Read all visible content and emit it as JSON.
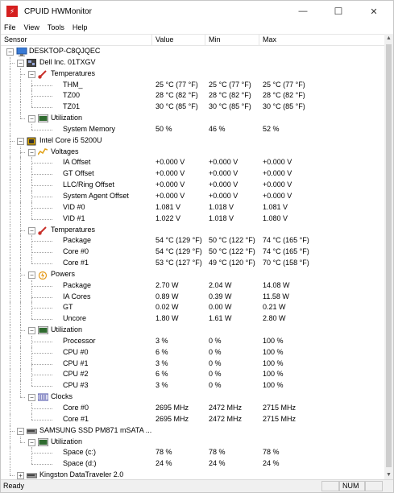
{
  "window": {
    "title": "CPUID HWMonitor",
    "minimize_glyph": "—",
    "maximize_glyph": "☐",
    "close_glyph": "✕"
  },
  "menu": {
    "file": "File",
    "view": "View",
    "tools": "Tools",
    "help": "Help"
  },
  "columns": {
    "sensor": "Sensor",
    "value": "Value",
    "min": "Min",
    "max": "Max"
  },
  "tree": [
    {
      "level": 0,
      "type": "root",
      "icon": "computer-icon",
      "label": "DESKTOP-C8QJQEC",
      "expanded": true
    },
    {
      "level": 1,
      "type": "device",
      "icon": "motherboard-icon",
      "label": "Dell Inc. 01TXGV",
      "expanded": true
    },
    {
      "level": 2,
      "type": "group",
      "icon": "thermometer-icon",
      "label": "Temperatures",
      "expanded": true
    },
    {
      "level": 3,
      "type": "sensor",
      "label": "THM_",
      "value": "25 °C  (77 °F)",
      "min": "25 °C  (77 °F)",
      "max": "25 °C  (77 °F)"
    },
    {
      "level": 3,
      "type": "sensor",
      "label": "TZ00",
      "value": "28 °C  (82 °F)",
      "min": "28 °C  (82 °F)",
      "max": "28 °C  (82 °F)"
    },
    {
      "level": 3,
      "type": "sensor",
      "label": "TZ01",
      "value": "30 °C  (85 °F)",
      "min": "30 °C  (85 °F)",
      "max": "30 °C  (85 °F)"
    },
    {
      "level": 2,
      "type": "group",
      "icon": "chip-icon",
      "label": "Utilization",
      "expanded": true
    },
    {
      "level": 3,
      "type": "sensor",
      "label": "System Memory",
      "value": "50 %",
      "min": "46 %",
      "max": "52 %"
    },
    {
      "level": 1,
      "type": "device",
      "icon": "cpu-icon",
      "label": "Intel Core i5 5200U",
      "expanded": true
    },
    {
      "level": 2,
      "type": "group",
      "icon": "voltage-icon",
      "label": "Voltages",
      "expanded": true
    },
    {
      "level": 3,
      "type": "sensor",
      "label": "IA Offset",
      "value": "+0.000 V",
      "min": "+0.000 V",
      "max": "+0.000 V"
    },
    {
      "level": 3,
      "type": "sensor",
      "label": "GT Offset",
      "value": "+0.000 V",
      "min": "+0.000 V",
      "max": "+0.000 V"
    },
    {
      "level": 3,
      "type": "sensor",
      "label": "LLC/Ring Offset",
      "value": "+0.000 V",
      "min": "+0.000 V",
      "max": "+0.000 V"
    },
    {
      "level": 3,
      "type": "sensor",
      "label": "System Agent Offset",
      "value": "+0.000 V",
      "min": "+0.000 V",
      "max": "+0.000 V"
    },
    {
      "level": 3,
      "type": "sensor",
      "label": "VID #0",
      "value": "1.081 V",
      "min": "1.018 V",
      "max": "1.081 V"
    },
    {
      "level": 3,
      "type": "sensor",
      "label": "VID #1",
      "value": "1.022 V",
      "min": "1.018 V",
      "max": "1.080 V"
    },
    {
      "level": 2,
      "type": "group",
      "icon": "thermometer-icon",
      "label": "Temperatures",
      "expanded": true
    },
    {
      "level": 3,
      "type": "sensor",
      "label": "Package",
      "value": "54 °C  (129 °F)",
      "min": "50 °C  (122 °F)",
      "max": "74 °C  (165 °F)"
    },
    {
      "level": 3,
      "type": "sensor",
      "label": "Core #0",
      "value": "54 °C  (129 °F)",
      "min": "50 °C  (122 °F)",
      "max": "74 °C  (165 °F)"
    },
    {
      "level": 3,
      "type": "sensor",
      "label": "Core #1",
      "value": "53 °C  (127 °F)",
      "min": "49 °C  (120 °F)",
      "max": "70 °C  (158 °F)"
    },
    {
      "level": 2,
      "type": "group",
      "icon": "power-icon",
      "label": "Powers",
      "expanded": true
    },
    {
      "level": 3,
      "type": "sensor",
      "label": "Package",
      "value": "2.70 W",
      "min": "2.04 W",
      "max": "14.08 W"
    },
    {
      "level": 3,
      "type": "sensor",
      "label": "IA Cores",
      "value": "0.89 W",
      "min": "0.39 W",
      "max": "11.58 W"
    },
    {
      "level": 3,
      "type": "sensor",
      "label": "GT",
      "value": "0.02 W",
      "min": "0.00 W",
      "max": "0.21 W"
    },
    {
      "level": 3,
      "type": "sensor",
      "label": "Uncore",
      "value": "1.80 W",
      "min": "1.61 W",
      "max": "2.80 W"
    },
    {
      "level": 2,
      "type": "group",
      "icon": "chip-icon",
      "label": "Utilization",
      "expanded": true
    },
    {
      "level": 3,
      "type": "sensor",
      "label": "Processor",
      "value": "3 %",
      "min": "0 %",
      "max": "100 %"
    },
    {
      "level": 3,
      "type": "sensor",
      "label": "CPU #0",
      "value": "6 %",
      "min": "0 %",
      "max": "100 %"
    },
    {
      "level": 3,
      "type": "sensor",
      "label": "CPU #1",
      "value": "3 %",
      "min": "0 %",
      "max": "100 %"
    },
    {
      "level": 3,
      "type": "sensor",
      "label": "CPU #2",
      "value": "6 %",
      "min": "0 %",
      "max": "100 %"
    },
    {
      "level": 3,
      "type": "sensor",
      "label": "CPU #3",
      "value": "3 %",
      "min": "0 %",
      "max": "100 %"
    },
    {
      "level": 2,
      "type": "group",
      "icon": "clock-icon",
      "label": "Clocks",
      "expanded": true
    },
    {
      "level": 3,
      "type": "sensor",
      "label": "Core #0",
      "value": "2695 MHz",
      "min": "2472 MHz",
      "max": "2715 MHz"
    },
    {
      "level": 3,
      "type": "sensor",
      "label": "Core #1",
      "value": "2695 MHz",
      "min": "2472 MHz",
      "max": "2715 MHz"
    },
    {
      "level": 1,
      "type": "device",
      "icon": "drive-icon",
      "label": "SAMSUNG SSD PM871 mSATA ...",
      "expanded": true
    },
    {
      "level": 2,
      "type": "group",
      "icon": "chip-icon",
      "label": "Utilization",
      "expanded": true
    },
    {
      "level": 3,
      "type": "sensor",
      "label": "Space (c:)",
      "value": "78 %",
      "min": "78 %",
      "max": "78 %"
    },
    {
      "level": 3,
      "type": "sensor",
      "label": "Space (d:)",
      "value": "24 %",
      "min": "24 %",
      "max": "24 %"
    },
    {
      "level": 1,
      "type": "device",
      "icon": "drive-icon",
      "label": "Kingston DataTraveler 2.0",
      "expanded": false
    }
  ],
  "status": {
    "text": "Ready",
    "num": "NUM"
  },
  "colors": {
    "app_icon": "#d51f1f",
    "computer_icon": "#3a7bd5",
    "thermometer": "#c8302a",
    "voltage": "#e0a21b",
    "power": "#e59a1a",
    "chip": "#2f6b2f",
    "clock": "#4a4fa8",
    "drive": "#555555"
  }
}
